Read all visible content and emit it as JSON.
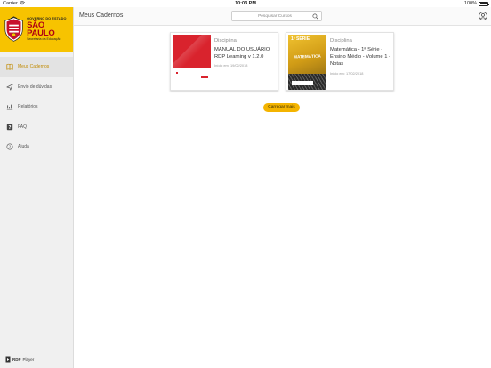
{
  "status_bar": {
    "carrier": "Carrier",
    "time": "10:03 PM",
    "battery_text": "100%",
    "icons": [
      "wifi-icon",
      "battery-icon"
    ]
  },
  "sidebar": {
    "logo": {
      "line1": "GOVERNO DO ESTADO",
      "line2": "SÃO PAULO",
      "line3": "Secretaria da Educação"
    },
    "items": [
      {
        "label": "Meus Cadernos",
        "icon": "book-icon",
        "active": true
      },
      {
        "label": "Envio de dúvidas",
        "icon": "send-icon",
        "active": false
      },
      {
        "label": "Relatórios",
        "icon": "report-icon",
        "active": false
      },
      {
        "label": "FAQ",
        "icon": "help-square-icon",
        "active": false
      },
      {
        "label": "Ajuda",
        "icon": "help-circle-icon",
        "active": false
      }
    ],
    "footer": {
      "brand_bold": "RDP",
      "brand_rest": "Player"
    }
  },
  "header": {
    "title": "Meus Cadernos",
    "search_placeholder": "Pesquisar Cursos"
  },
  "cards": [
    {
      "kind": "Disciplina",
      "title": "MANUAL DO USUÁRIO RDP Learning v 1.2.0",
      "date": "Início em: 19/02/2018"
    },
    {
      "kind": "Disciplina",
      "title": "Matemática - 1ª Série - Ensino Médio - Volume 1 - Notas",
      "date": "Início em: 17/02/2018",
      "cover_serie": "1ª SÉRIE",
      "cover_subject": "MATEMÁTICA"
    }
  ],
  "load_more_label": "Carregar mais",
  "colors": {
    "brand_yellow": "#f7c300",
    "active_text": "#c08a00",
    "button_yellow": "#f4b400",
    "sp_red": "#b00012"
  }
}
